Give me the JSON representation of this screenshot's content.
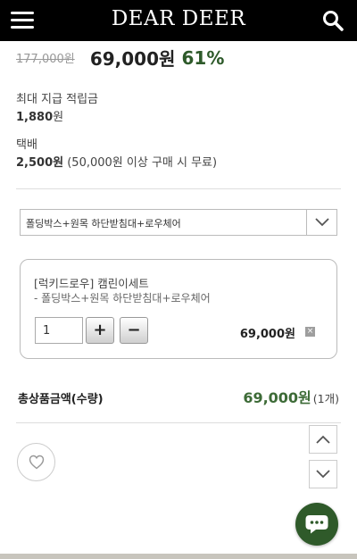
{
  "header": {
    "logo": "DEAR DEER",
    "menu_icon": "hamburger-menu-icon",
    "search_icon": "search-icon",
    "background": "#000000"
  },
  "product": {
    "original_price": "177,000원",
    "sale_price": "69,000원",
    "discount": "61%",
    "discount_color": "#2e5a2a"
  },
  "points": {
    "label": "최대 지급 적립금",
    "amount": "1,880",
    "unit": "원"
  },
  "shipping": {
    "label": "택배",
    "fee": "2,500원",
    "note": "(50,000원 이상 구매 시 무료)"
  },
  "option_select": {
    "selected": "폴딩박스+원목 하단받침대+로우체어",
    "icon": "chevron-down-icon"
  },
  "selected_option": {
    "title": "[럭키드로우] 캠린이세트",
    "subtitle": "- 폴딩박스+원목 하단받침대+로우체어",
    "quantity": "1",
    "plus_label": "+",
    "minus_label": "−",
    "price": "69,000원",
    "remove_label": "×"
  },
  "total": {
    "label": "총상품금액(수량)",
    "amount": "69,000원",
    "count": "(1개)",
    "color": "#3d6b37"
  },
  "actions": {
    "wishlist_icon": "heart-icon",
    "scroll_up_icon": "chevron-up-icon",
    "scroll_down_icon": "chevron-down-icon",
    "chat_icon": "chat-bubble-icon",
    "chat_color": "#2f5a2a"
  }
}
